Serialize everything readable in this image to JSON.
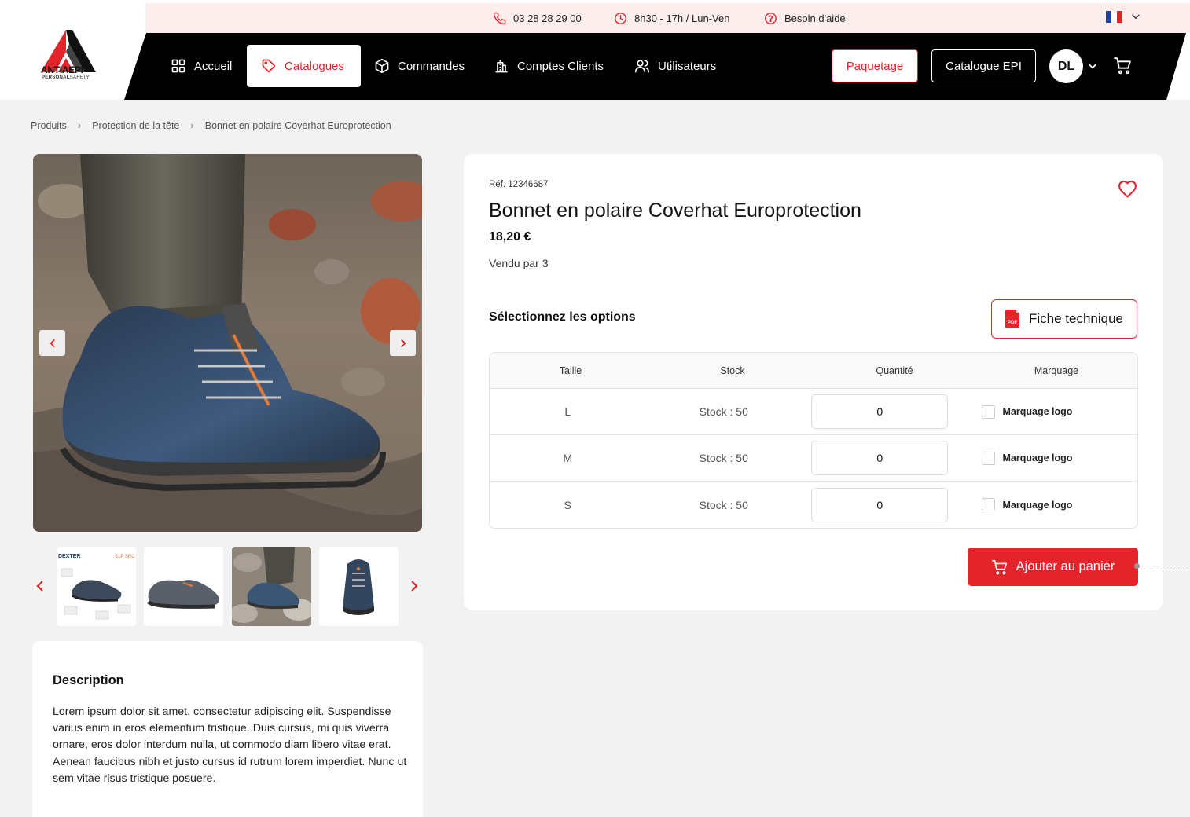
{
  "topbar": {
    "phone": "03 28 28 29 00",
    "hours": "8h30 - 17h / Lun-Ven",
    "help": "Besoin d'aide"
  },
  "brand": {
    "name_part1": "ANTIA",
    "name_part2": "EPI",
    "tagline_bold": "PERSONAL",
    "tagline_rest": "SAFETY",
    "accent": "#e3242b"
  },
  "nav": {
    "home": "Accueil",
    "catalogues": "Catalogues",
    "orders": "Commandes",
    "accounts": "Comptes Clients",
    "users": "Utilisateurs",
    "paquetage": "Paquetage",
    "catalogue_epi": "Catalogue EPI",
    "avatar_initials": "DL"
  },
  "breadcrumb": {
    "items": [
      "Produits",
      "Protection de la tête",
      "Bonnet en polaire Coverhat Europrotection"
    ]
  },
  "product": {
    "ref": "Réf. 12346687",
    "title": "Bonnet en polaire Coverhat Europrotection",
    "price": "18,20 €",
    "seller": "Vendu par 3",
    "options_title": "Sélectionnez les options",
    "fiche_label": "Fiche technique",
    "add_to_cart": "Ajouter au panier"
  },
  "options_table": {
    "headers": [
      "Taille",
      "Stock",
      "Quantité",
      "Marquage"
    ],
    "rows": [
      {
        "size": "L",
        "stock": "Stock : 50",
        "qty": "0",
        "marking": "Marquage logo"
      },
      {
        "size": "M",
        "stock": "Stock : 50",
        "qty": "0",
        "marking": "Marquage logo"
      },
      {
        "size": "S",
        "stock": "Stock : 50",
        "qty": "0",
        "marking": "Marquage logo"
      }
    ]
  },
  "thumbnails": {
    "brand_text": "DEXTER",
    "model_text": "S1P SRC"
  },
  "description": {
    "title": "Description",
    "text": "Lorem ipsum dolor sit amet, consectetur adipiscing elit. Suspendisse varius enim in eros elementum tristique. Duis cursus, mi quis viverra ornare, eros dolor interdum nulla, ut commodo diam libero vitae erat. Aenean faucibus nibh et justo cursus id rutrum lorem imperdiet. Nunc ut sem vitae risus tristique posuere."
  }
}
